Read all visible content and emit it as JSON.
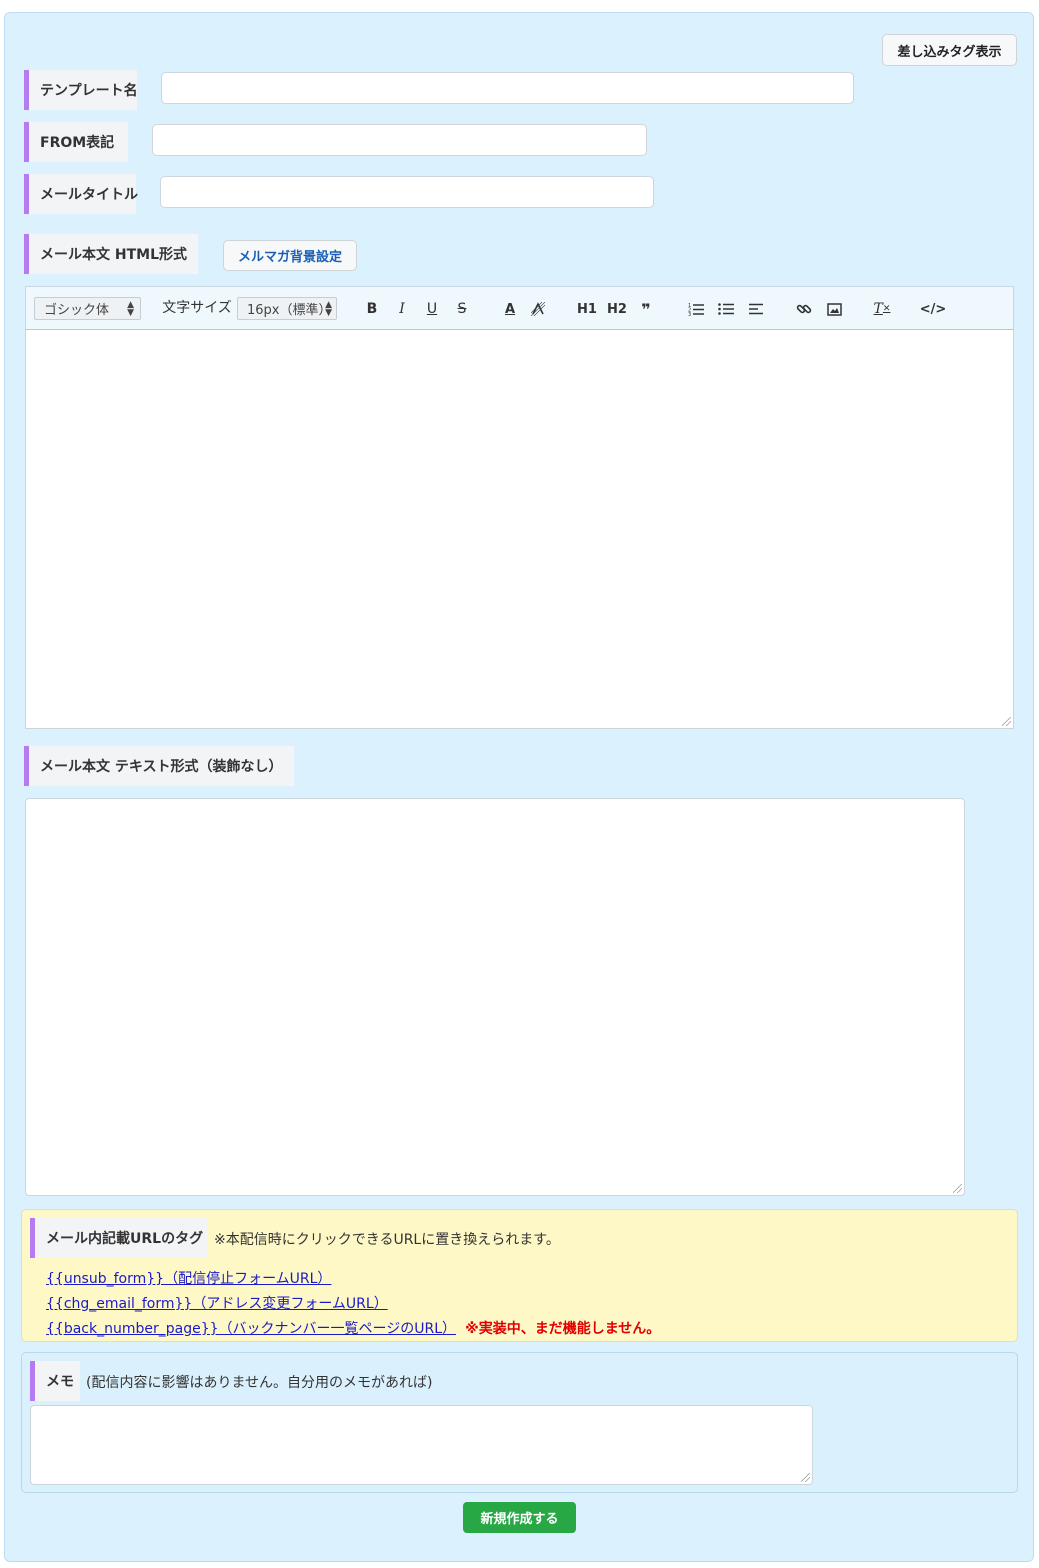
{
  "header": {
    "merge_tag_button": "差し込みタグ表示"
  },
  "fields": {
    "template_name_label": "テンプレート名",
    "from_label": "FROM表記",
    "mail_title_label": "メールタイトル",
    "html_body_label": "メール本文 HTML形式",
    "bg_setting_button": "メルマガ背景設定",
    "text_body_label": "メール本文 テキスト形式（装飾なし）"
  },
  "toolbar": {
    "font_select": "ゴシック体",
    "font_size_label": "文字サイズ",
    "font_size_select": "16px（標準）",
    "h1": "H1",
    "h2": "H2",
    "quote": "❞",
    "clear": "T",
    "code": "</>"
  },
  "url_tags": {
    "label": "メール内記載URLのタグ",
    "note": "※本配信時にクリックできるURLに置き換えられます。",
    "items": [
      "{{unsub_form}}（配信停止フォームURL）",
      "{{chg_email_form}}（アドレス変更フォームURL）",
      "{{back_number_page}}（バックナンバー一覧ページのURL）"
    ],
    "warning": "※実装中、まだ機能しません。"
  },
  "memo": {
    "label": "メモ",
    "note": "(配信内容に影響はありません。自分用のメモがあれば)"
  },
  "submit_button": "新規作成する"
}
